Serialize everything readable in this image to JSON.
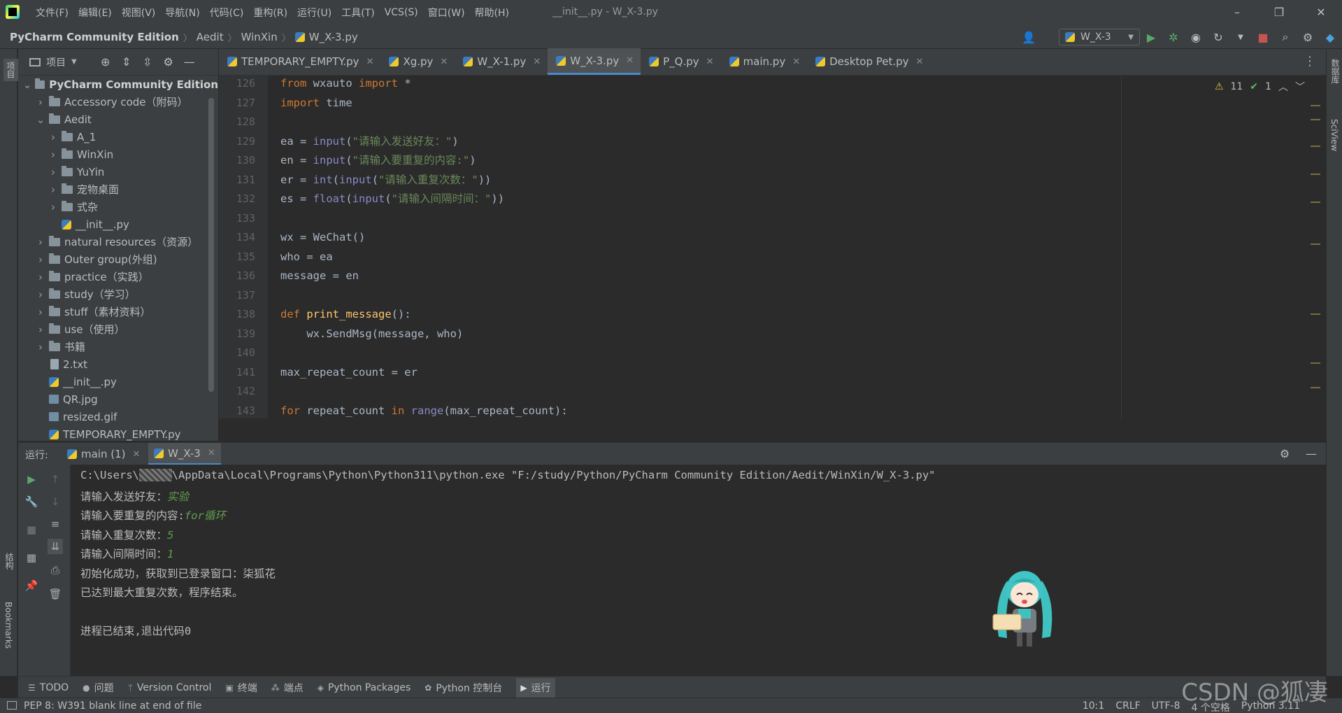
{
  "menubar": {
    "menus": [
      "文件(F)",
      "编辑(E)",
      "视图(V)",
      "导航(N)",
      "代码(C)",
      "重构(R)",
      "运行(U)",
      "工具(T)",
      "VCS(S)",
      "窗口(W)",
      "帮助(H)"
    ],
    "window_title": "__init__.py - W_X-3.py",
    "controls": [
      "–",
      "❐",
      "✕"
    ]
  },
  "navbar": {
    "breadcrumbs": [
      "PyCharm Community Edition",
      "Aedit",
      "WinXin",
      "W_X-3.py"
    ],
    "run_config": "W_X-3"
  },
  "left_strip": {
    "project_label": "项目",
    "structure_label": "结构",
    "bookmarks_label": "Bookmarks"
  },
  "right_strip": {
    "database_label": "数据库",
    "sciview_label": "SciView"
  },
  "project": {
    "header": "项目",
    "tree": [
      {
        "label": "PyCharm Community Edition",
        "type": "folder",
        "depth": 0,
        "expanded": true,
        "bold": true
      },
      {
        "label": "Accessory code（附码）",
        "type": "folder",
        "depth": 1,
        "expanded": false
      },
      {
        "label": "Aedit",
        "type": "folder",
        "depth": 1,
        "expanded": true
      },
      {
        "label": "A_1",
        "type": "folder",
        "depth": 2,
        "expanded": false
      },
      {
        "label": "WinXin",
        "type": "folder",
        "depth": 2,
        "expanded": false
      },
      {
        "label": "YuYin",
        "type": "folder",
        "depth": 2,
        "expanded": false
      },
      {
        "label": "宠物桌面",
        "type": "folder",
        "depth": 2,
        "expanded": false
      },
      {
        "label": "式杂",
        "type": "folder",
        "depth": 2,
        "expanded": false
      },
      {
        "label": "__init__.py",
        "type": "py",
        "depth": 2,
        "leaf": true
      },
      {
        "label": "natural resources（资源）",
        "type": "folder",
        "depth": 1,
        "expanded": false
      },
      {
        "label": "Outer group(外组)",
        "type": "folder",
        "depth": 1,
        "expanded": false
      },
      {
        "label": "practice（实践）",
        "type": "folder",
        "depth": 1,
        "expanded": false
      },
      {
        "label": "study（学习）",
        "type": "folder",
        "depth": 1,
        "expanded": false
      },
      {
        "label": "stuff（素材资料）",
        "type": "folder",
        "depth": 1,
        "expanded": false
      },
      {
        "label": "use（使用）",
        "type": "folder",
        "depth": 1,
        "expanded": false
      },
      {
        "label": "书籍",
        "type": "folder",
        "depth": 1,
        "expanded": false
      },
      {
        "label": "2.txt",
        "type": "txt",
        "depth": 1,
        "leaf": true
      },
      {
        "label": "__init__.py",
        "type": "py",
        "depth": 1,
        "leaf": true
      },
      {
        "label": "QR.jpg",
        "type": "img",
        "depth": 1,
        "leaf": true
      },
      {
        "label": "resized.gif",
        "type": "img",
        "depth": 1,
        "leaf": true
      },
      {
        "label": "TEMPORARY_EMPTY.py",
        "type": "py",
        "depth": 1,
        "leaf": true
      }
    ]
  },
  "tabs": [
    {
      "label": "TEMPORARY_EMPTY.py",
      "active": false
    },
    {
      "label": "Xg.py",
      "active": false
    },
    {
      "label": "W_X-1.py",
      "active": false
    },
    {
      "label": "W_X-3.py",
      "active": true
    },
    {
      "label": "P_Q.py",
      "active": false
    },
    {
      "label": "main.py",
      "active": false
    },
    {
      "label": "Desktop Pet.py",
      "active": false
    }
  ],
  "editor": {
    "line_numbers": [
      "126",
      "127",
      "128",
      "129",
      "130",
      "131",
      "132",
      "133",
      "134",
      "135",
      "136",
      "137",
      "138",
      "139",
      "140",
      "141",
      "142",
      "143"
    ],
    "inspections": {
      "warnings": "11",
      "ok": "1"
    },
    "lines": [
      "from wxauto import *",
      "import time",
      "",
      "ea = input(\"请输入发送好友：\")",
      "en = input(\"请输入要重复的内容:\")",
      "er = int(input(\"请输入重复次数：\"))",
      "es = float(input(\"请输入间隔时间：\"))",
      "",
      "wx = WeChat()",
      "who = ea",
      "message = en",
      "",
      "def print_message():",
      "    wx.SendMsg(message, who)",
      "",
      "max_repeat_count = er",
      "",
      "for repeat_count in range(max_repeat_count):"
    ]
  },
  "run": {
    "label": "运行:",
    "tabs": [
      {
        "label": "main (1)",
        "active": false
      },
      {
        "label": "W_X-3",
        "active": true
      }
    ],
    "console": {
      "cmd_prefix": "C:\\Users\\",
      "cmd_blurred": "xxxxx",
      "cmd_suffix": "\\AppData\\Local\\Programs\\Python\\Python311\\python.exe \"F:/study/Python/PyCharm Community Edition/Aedit/WinXin/W_X-3.py\"",
      "prompt1": "请输入发送好友：",
      "input1": "实验",
      "prompt2": "请输入要重复的内容:",
      "input2": "for循环",
      "prompt3": "请输入重复次数：",
      "input3": "5",
      "prompt4": "请输入间隔时间：",
      "input4": "1",
      "line5": "初始化成功，获取到已登录窗口：柒狐花",
      "line6": "已达到最大重复次数，程序结束。",
      "line7": "进程已结束,退出代码0"
    }
  },
  "bottombar": {
    "items": [
      "TODO",
      "问题",
      "Version Control",
      "终端",
      "端点",
      "Python Packages",
      "Python 控制台",
      "运行"
    ]
  },
  "status": {
    "message": "PEP 8: W391 blank line at end of file",
    "position": "10:1",
    "line_sep": "CRLF",
    "encoding": "UTF-8",
    "indent": "4 个空格",
    "interpreter": "Python 3.11"
  },
  "watermark": "CSDN @狐凄"
}
